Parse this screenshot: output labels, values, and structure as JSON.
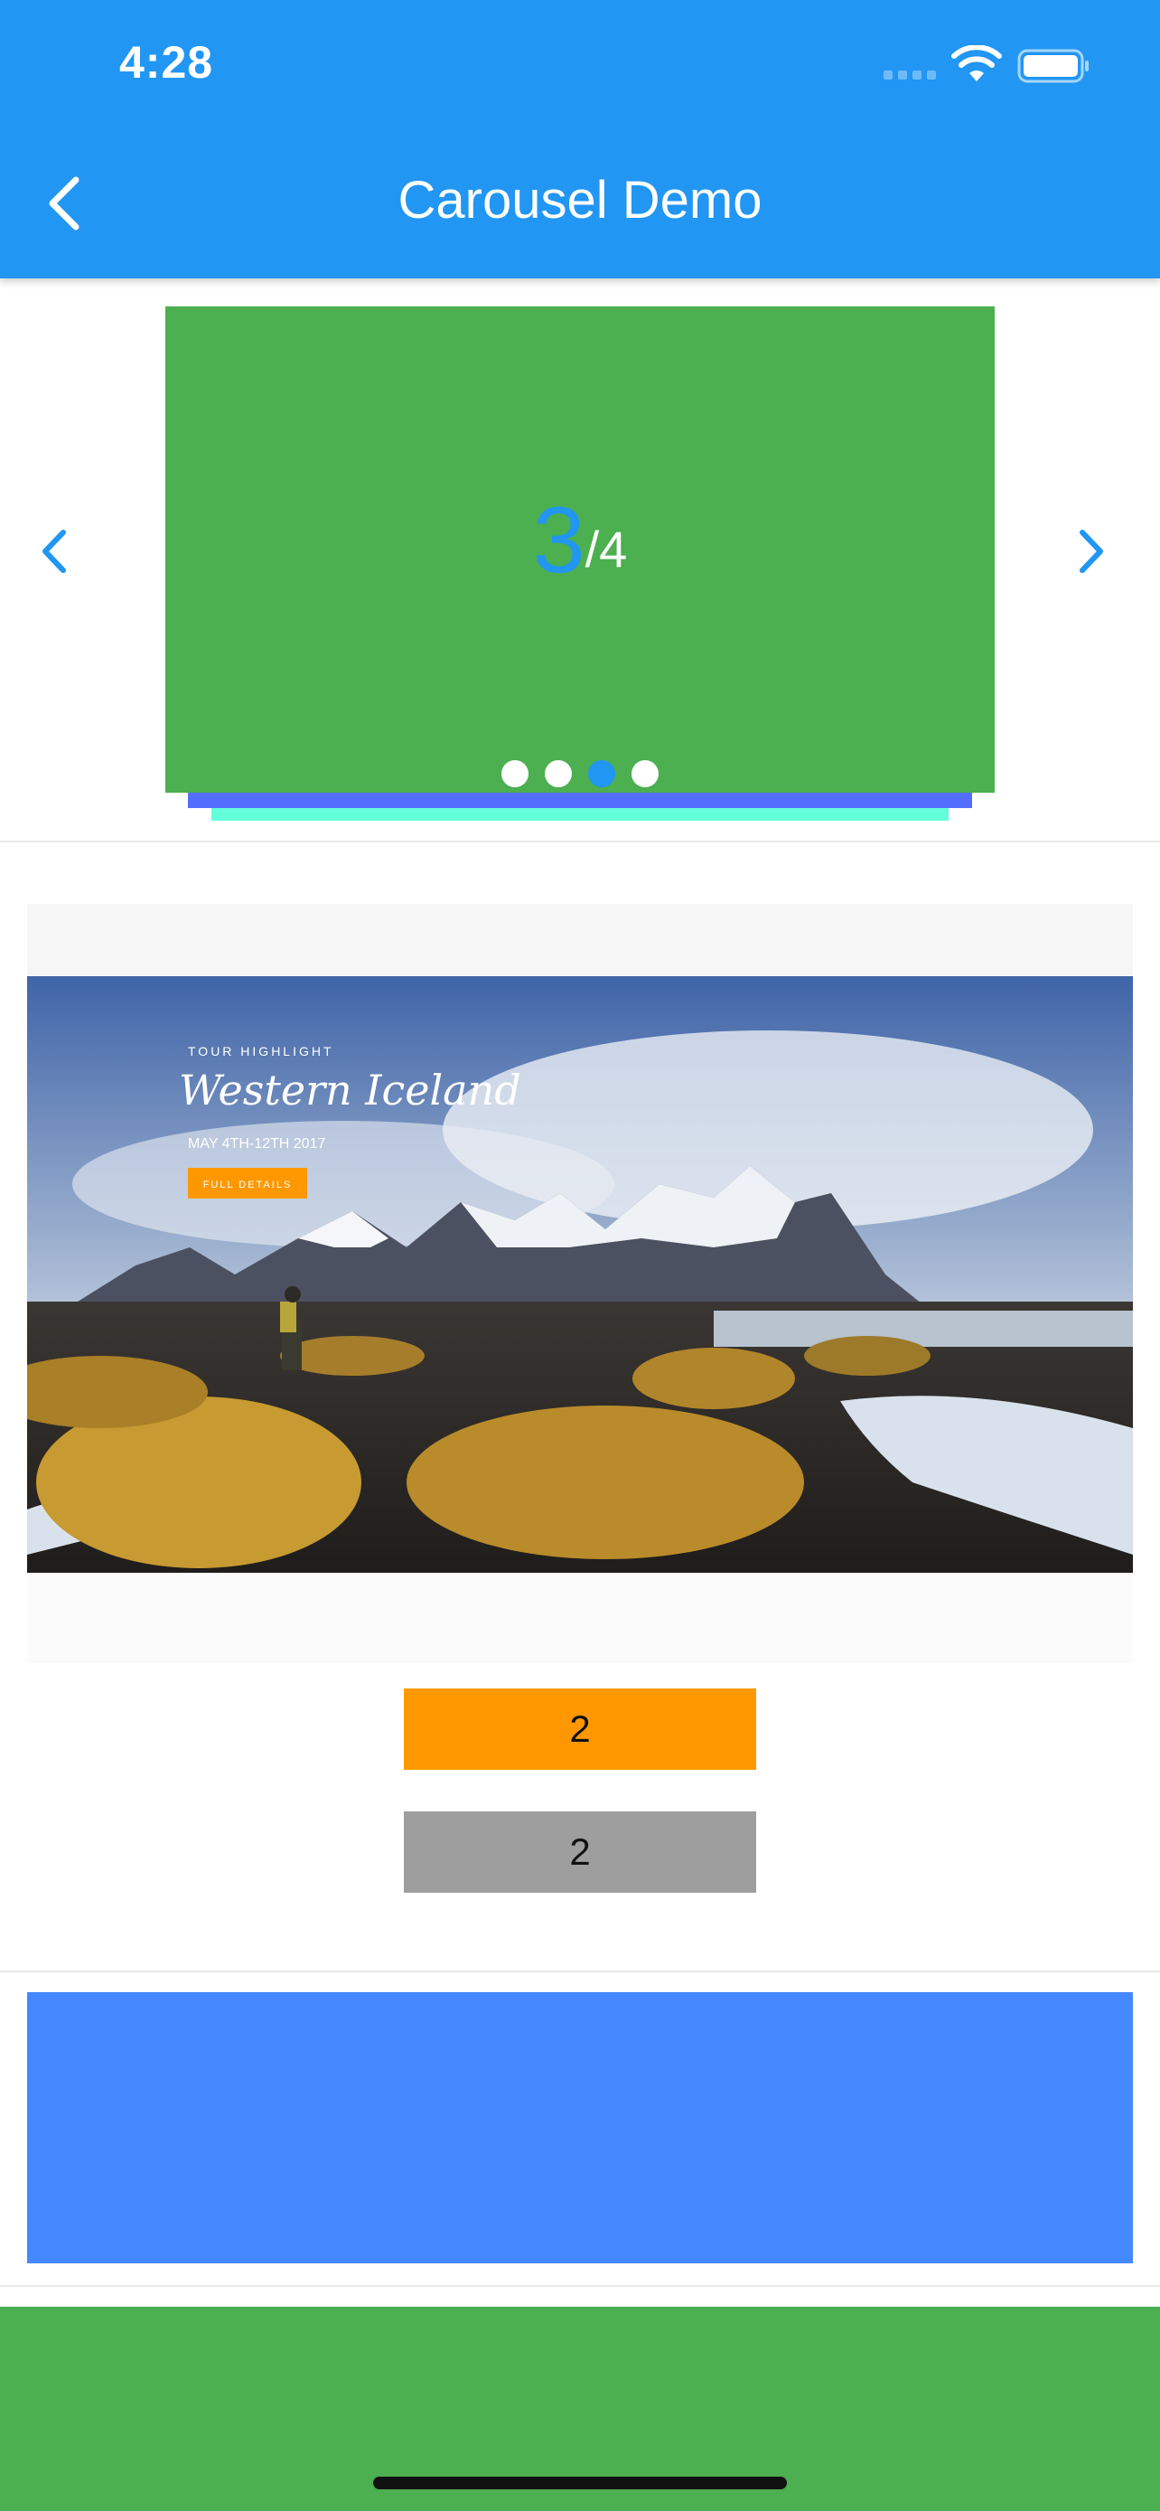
{
  "status_bar": {
    "time": "4:28"
  },
  "header": {
    "title": "Carousel Demo"
  },
  "carousel": {
    "current": "3",
    "total_text": "/4",
    "dots": [
      false,
      false,
      true,
      false
    ]
  },
  "image_slide": {
    "tour_highlight": "TOUR HIGHLIGHT",
    "headline": "Western Iceland",
    "date_text": "MAY 4TH-12TH 2017",
    "button_label": "FULL DETAILS"
  },
  "indicators": {
    "orange_value": "2",
    "grey_value": "2"
  },
  "colors": {
    "primary": "#2196F3",
    "slide_green": "#4CAF50",
    "orange": "#FF9800",
    "grey": "#9E9E9E",
    "blue_panel": "#4488FF"
  }
}
